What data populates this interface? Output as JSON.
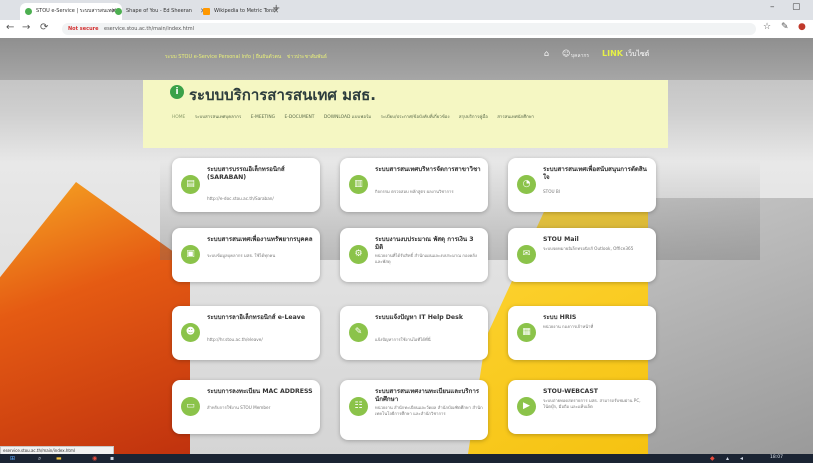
{
  "browser": {
    "tabs": [
      {
        "label": "STOU e-Service | ระบบสารสนเทศ",
        "active": true,
        "favicon_color": "#4caf50"
      },
      {
        "label": "Shape of You - Ed Sheeran",
        "active": false,
        "favicon_color": "#4caf50"
      },
      {
        "label": "Wikipedia to Metric Tons",
        "active": false,
        "favicon_color": "#ff9800"
      }
    ],
    "new_tab_icon": "plus-icon",
    "address": {
      "security_label": "Not secure",
      "url": "eservice.stou.ac.th/main/index.html"
    },
    "window_controls": [
      "minimize-icon",
      "maximize-icon"
    ]
  },
  "site": {
    "notice_1": "ระบบ STOU e-Service Personal Info | ยืนยันตัวตน",
    "notice_2": "ข่าวประชาสัมพันธ์",
    "top_user_label": "บุคลากร",
    "link_label": "LINK",
    "link_sub": "เว็บไซต์",
    "brand_title": "ระบบบริการสารสนเทศ มสธ.",
    "menu": [
      "HOME",
      "ระบบสารสนเทศบุคลากร",
      "E-MEETING",
      "E-DOCUMENT",
      "DOWNLOAD แบบฟอร์ม",
      "ระเบียบ/ประกาศ/ข้อบังคับที่เกี่ยวข้อง",
      "สรุปบริการคู่มือ",
      "สารสนเทศนักศึกษา"
    ]
  },
  "cards": [
    {
      "title": "ระบบสารบรรณอิเล็กทรอนิกส์ (SARABAN)",
      "sub": "http://e-doc.stou.ac.th/Saraban/",
      "icon": "document-icon"
    },
    {
      "title": "ระบบสารสนเทศบริหารจัดการสาขาวิชา",
      "sub": "กิจกรรม ตรวจสอบ หลักสูตร ผลงานวิชาการ",
      "icon": "bar-chart-icon"
    },
    {
      "title": "ระบบสารสนเทศเพื่อสนับสนุนการตัดสินใจ",
      "sub": "STOU BI",
      "icon": "pie-chart-icon"
    },
    {
      "title": "ระบบสารสนเทศเพื่องานทรัพยากรบุคคล",
      "sub": "ระบบข้อมูลบุคลากร มสธ. ใช้ได้ทุกคน",
      "icon": "id-card-icon"
    },
    {
      "title": "ระบบงานงบประมาณ พัสดุ การเงิน 3 มิติ",
      "sub": "หน่วยงานที่ได้รับสิทธิ์ สำนักแผนและงบประมาณ กองคลัง และพัสดุ",
      "icon": "gears-icon"
    },
    {
      "title": "STOU Mail",
      "sub": "ระบบจดหมายอิเล็กทรอนิกส์ Outlook, Office365",
      "icon": "mail-icon"
    },
    {
      "title": "ระบบการลาอิเล็กทรอนิกส์ e-Leave",
      "sub": "http://hr.stou.ac.th/eleave/",
      "icon": "user-group-icon"
    },
    {
      "title": "ระบบแจ้งปัญหา IT Help Desk",
      "sub": "แจ้งปัญหาการใช้งานไอทีได้ที่นี่",
      "icon": "wrench-icon"
    },
    {
      "title": "ระบบ HRIS",
      "sub": "หน่วยงาน กองการเจ้าหน้าที่",
      "icon": "clipboard-icon"
    },
    {
      "title": "ระบบการลงทะเบียน MAC ADDRESS",
      "sub": "สำหรับการใช้งาน STOU Member",
      "icon": "laptop-icon"
    },
    {
      "title": "ระบบสารสนเทศงานทะเบียนและบริการนักศึกษา",
      "sub": "หน่วยงาน สำนักทะเบียนและวัดผล สำนักบัณฑิตศึกษา สำนักเทคโนโลยีการศึกษา และสำนักวิชาการ",
      "icon": "students-icon"
    },
    {
      "title": "STOU-WEBCAST",
      "sub": "ระบบถ่ายทอดสดรายการ มสธ. สามารถรับชมผ่าน PC, โน้ตบุ๊ก, มือถือ และแท็บเล็ต",
      "icon": "play-icon"
    }
  ],
  "status_bar_text": "eservice.stou.ac.th/main/index.html",
  "taskbar": {
    "icons": [
      "windows-icon",
      "search-icon",
      "file-explorer-icon",
      "chrome-icon",
      "files-icon"
    ],
    "clock": "18:07"
  },
  "colors": {
    "brand_green": "#3aa148",
    "band_bg": "#f5f7c3",
    "card_icon": "#8bc34a",
    "link_yellow": "#e6f048"
  }
}
